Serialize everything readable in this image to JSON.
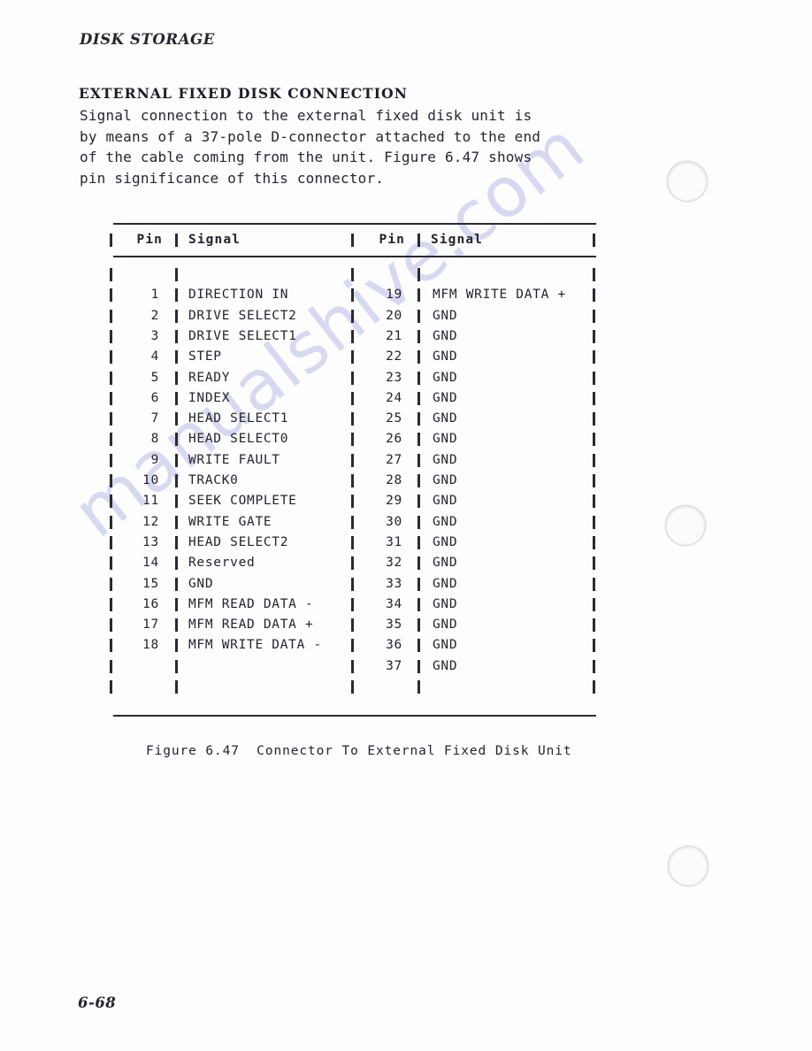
{
  "page": {
    "running_head": "DISK STORAGE",
    "page_number": "6-68",
    "watermark": "manualshive.com"
  },
  "section": {
    "heading": "EXTERNAL FIXED DISK CONNECTION",
    "paragraph_lines": [
      "Signal connection to the external fixed disk unit is",
      "by means of a 37-pole D-connector attached to the end",
      "of the cable coming from the unit. Figure 6.47 shows",
      "pin significance of this connector."
    ]
  },
  "figure": {
    "caption": "Figure 6.47  Connector To External Fixed Disk Unit",
    "table": {
      "headers": [
        "Pin",
        "Signal",
        "Pin",
        "Signal"
      ],
      "left_rows": [
        {
          "pin": "1",
          "signal": "DIRECTION IN"
        },
        {
          "pin": "2",
          "signal": "DRIVE SELECT2"
        },
        {
          "pin": "3",
          "signal": "DRIVE SELECT1"
        },
        {
          "pin": "4",
          "signal": "STEP"
        },
        {
          "pin": "5",
          "signal": "READY"
        },
        {
          "pin": "6",
          "signal": "INDEX"
        },
        {
          "pin": "7",
          "signal": "HEAD SELECT1"
        },
        {
          "pin": "8",
          "signal": "HEAD SELECT0"
        },
        {
          "pin": "9",
          "signal": "WRITE FAULT"
        },
        {
          "pin": "10",
          "signal": "TRACK0"
        },
        {
          "pin": "11",
          "signal": "SEEK COMPLETE"
        },
        {
          "pin": "12",
          "signal": "WRITE GATE"
        },
        {
          "pin": "13",
          "signal": "HEAD SELECT2"
        },
        {
          "pin": "14",
          "signal": "Reserved"
        },
        {
          "pin": "15",
          "signal": "GND"
        },
        {
          "pin": "16",
          "signal": "MFM READ DATA -"
        },
        {
          "pin": "17",
          "signal": "MFM READ DATA +"
        },
        {
          "pin": "18",
          "signal": "MFM WRITE DATA -"
        },
        {
          "pin": "",
          "signal": ""
        }
      ],
      "right_rows": [
        {
          "pin": "19",
          "signal": "MFM WRITE DATA +"
        },
        {
          "pin": "20",
          "signal": "GND"
        },
        {
          "pin": "21",
          "signal": "GND"
        },
        {
          "pin": "22",
          "signal": "GND"
        },
        {
          "pin": "23",
          "signal": "GND"
        },
        {
          "pin": "24",
          "signal": "GND"
        },
        {
          "pin": "25",
          "signal": "GND"
        },
        {
          "pin": "26",
          "signal": "GND"
        },
        {
          "pin": "27",
          "signal": "GND"
        },
        {
          "pin": "28",
          "signal": "GND"
        },
        {
          "pin": "29",
          "signal": "GND"
        },
        {
          "pin": "30",
          "signal": "GND"
        },
        {
          "pin": "31",
          "signal": "GND"
        },
        {
          "pin": "32",
          "signal": "GND"
        },
        {
          "pin": "33",
          "signal": "GND"
        },
        {
          "pin": "34",
          "signal": "GND"
        },
        {
          "pin": "35",
          "signal": "GND"
        },
        {
          "pin": "36",
          "signal": "GND"
        },
        {
          "pin": "37",
          "signal": "GND"
        }
      ]
    }
  }
}
